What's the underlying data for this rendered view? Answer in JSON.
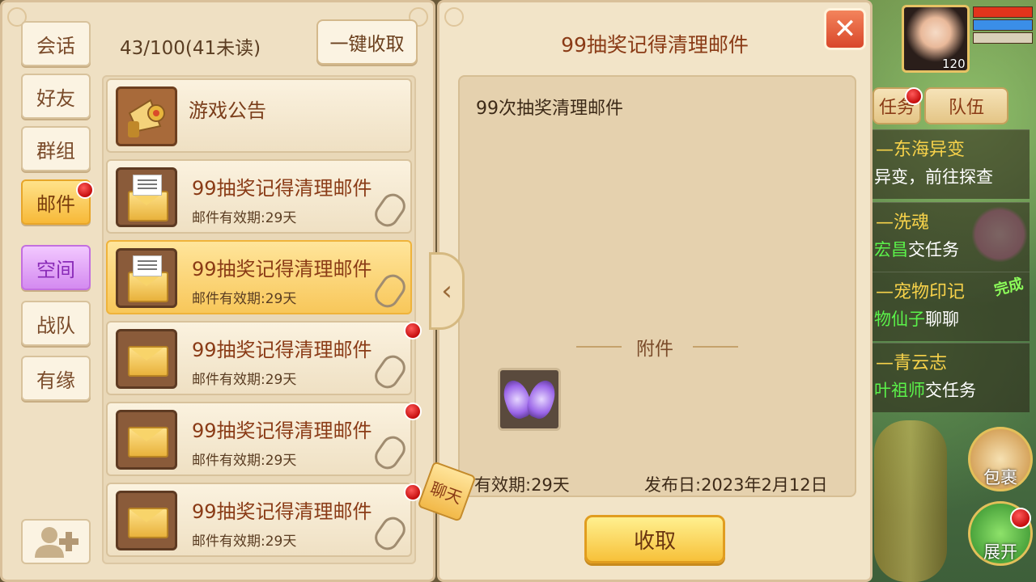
{
  "tabs": [
    {
      "label": "会话"
    },
    {
      "label": "好友"
    },
    {
      "label": "群组"
    },
    {
      "label": "邮件"
    },
    {
      "label": "空间"
    },
    {
      "label": "战队"
    },
    {
      "label": "有缘"
    }
  ],
  "header": {
    "count": "43/100(41未读)",
    "collect_all": "一键收取"
  },
  "mail_list": [
    {
      "title": "游戏公告"
    },
    {
      "title": "99抽奖记得清理邮件",
      "sub": "邮件有效期:29天"
    },
    {
      "title": "99抽奖记得清理邮件",
      "sub": "邮件有效期:29天"
    },
    {
      "title": "99抽奖记得清理邮件",
      "sub": "邮件有效期:29天"
    },
    {
      "title": "99抽奖记得清理邮件",
      "sub": "邮件有效期:29天"
    },
    {
      "title": "99抽奖记得清理邮件",
      "sub": "邮件有效期:29天"
    }
  ],
  "detail": {
    "title": "99抽奖记得清理邮件",
    "content": "99次抽奖清理邮件",
    "attachment_label": "附件",
    "expire": "有效期:29天",
    "publish_date": "发布日:2023年2月12日",
    "receive": "收取"
  },
  "chat_tag": "聊天",
  "hud": {
    "level": "120",
    "tab_task": "任务",
    "tab_team": "队伍",
    "quests": [
      {
        "title": "—东海异变",
        "desc_plain": "异变，前往探查"
      },
      {
        "title": "—洗魂",
        "desc_green": "宏昌",
        "desc_plain": "交任务"
      },
      {
        "title": "—宠物印记",
        "desc_green": "物仙子",
        "desc_plain": "聊聊",
        "badge": "完成"
      },
      {
        "title": "—青云志",
        "desc_green": "叶祖师",
        "desc_plain": "交任务"
      }
    ],
    "bag": "包裹",
    "expand": "展开"
  },
  "colors": {
    "accent_gold": "#f7c13a",
    "title_brown": "#8a3b16",
    "unread_red": "#d91c1c"
  }
}
